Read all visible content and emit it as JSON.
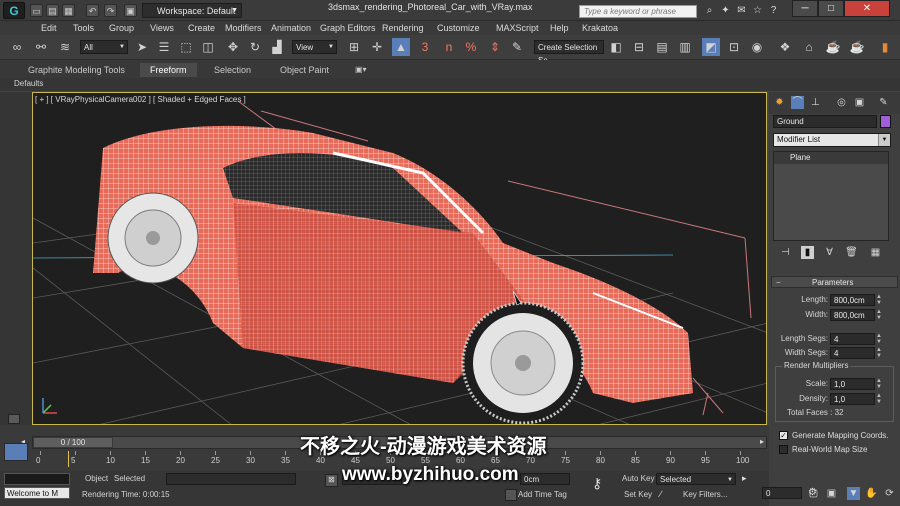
{
  "titlebar": {
    "logo": "G",
    "workspace": "Workspace: Default",
    "window_title": "3dsmax_rendering_Photoreal_Car_with_VRay.max",
    "search_placeholder": "Type a keyword or phrase",
    "min": "─",
    "max": "□",
    "close": "✕"
  },
  "menu": [
    "Edit",
    "Tools",
    "Group",
    "Views",
    "Create",
    "Modifiers",
    "Animation",
    "Graph Editors",
    "Rendering",
    "Customize",
    "MAXScript",
    "Help",
    "Krakatoa"
  ],
  "toolbar": {
    "filter": "All",
    "ref_coord": "View",
    "selection_set": "Create Selection Se",
    "snap_label": "3",
    "angle_label": "n"
  },
  "ribbon": {
    "tabs": [
      "Graphite Modeling Tools",
      "Freeform",
      "Selection",
      "Object Paint"
    ],
    "active_tab": "Freeform",
    "defaults": "Defaults"
  },
  "viewport": {
    "label": "[ + ] [ VRayPhysicalCamera002 ] [ Shaded + Edged Faces ]"
  },
  "command_panel": {
    "object_name": "Ground",
    "object_color": "#9f5fd6",
    "modifier_list": "Modifier List",
    "stack_item": "Plane",
    "rollout_title": "Parameters",
    "length_label": "Length:",
    "length_value": "800,0cm",
    "width_label": "Width:",
    "width_value": "800,0cm",
    "length_segs_label": "Length Segs:",
    "length_segs_value": "4",
    "width_segs_label": "Width Segs:",
    "width_segs_value": "4",
    "render_mult_title": "Render Multipliers",
    "scale_label": "Scale:",
    "scale_value": "1,0",
    "density_label": "Density:",
    "density_value": "1,0",
    "total_faces": "Total Faces : 32",
    "gen_mapping_label": "Generate Mapping Coords.",
    "gen_mapping_checked": true,
    "realworld_label": "Real-World Map Size",
    "realworld_checked": false
  },
  "timeline": {
    "frame_counter": "0 / 100",
    "ticks": [
      "0",
      "5",
      "10",
      "15",
      "20",
      "25",
      "30",
      "35",
      "40",
      "45",
      "50",
      "55",
      "60",
      "65",
      "70",
      "75",
      "80",
      "85",
      "90",
      "95",
      "100"
    ],
    "selected_label": "Selected",
    "object_label": "Object",
    "grid_value": "0cm",
    "rendering_time": "Rendering Time: 0:00:15",
    "maxscript_text": "Welcome to M",
    "add_time_tag": "Add Time Tag",
    "auto_key": "Auto Key",
    "set_key": "Set Key",
    "key_mode": "Selected",
    "key_filters": "Key Filters...",
    "current_frame": "0"
  },
  "watermark": {
    "line1": "不移之火-动漫游戏美术资源",
    "line2": "www.byzhihuo.com"
  }
}
